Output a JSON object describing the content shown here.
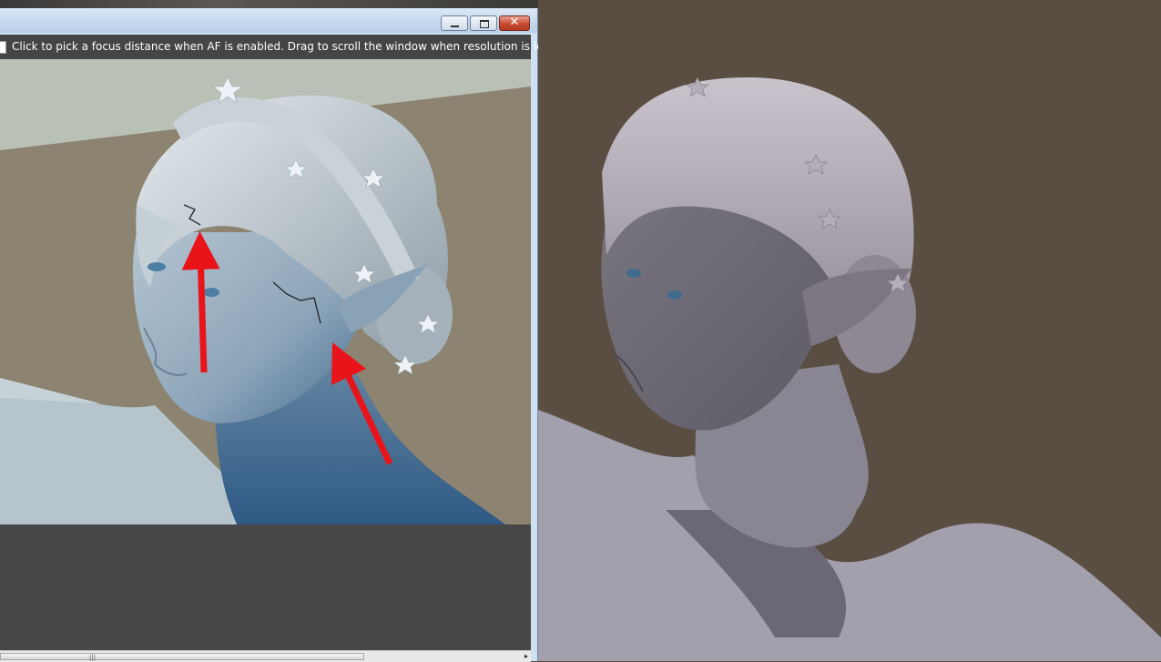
{
  "window": {
    "controls": {
      "minimize": "minimize",
      "maximize": "maximize",
      "close": "✕"
    },
    "hint": "Click to pick a focus distance when AF is enabled.  Drag to scroll the window when resolution is locked"
  },
  "scrollbar": {
    "grip": "|||",
    "arrow": "▸"
  },
  "colors": {
    "viewport_background": "#8c8370",
    "lower_panel": "#474747",
    "right_background": "#5a4d42",
    "annotation_arrow": "#e8141a"
  }
}
